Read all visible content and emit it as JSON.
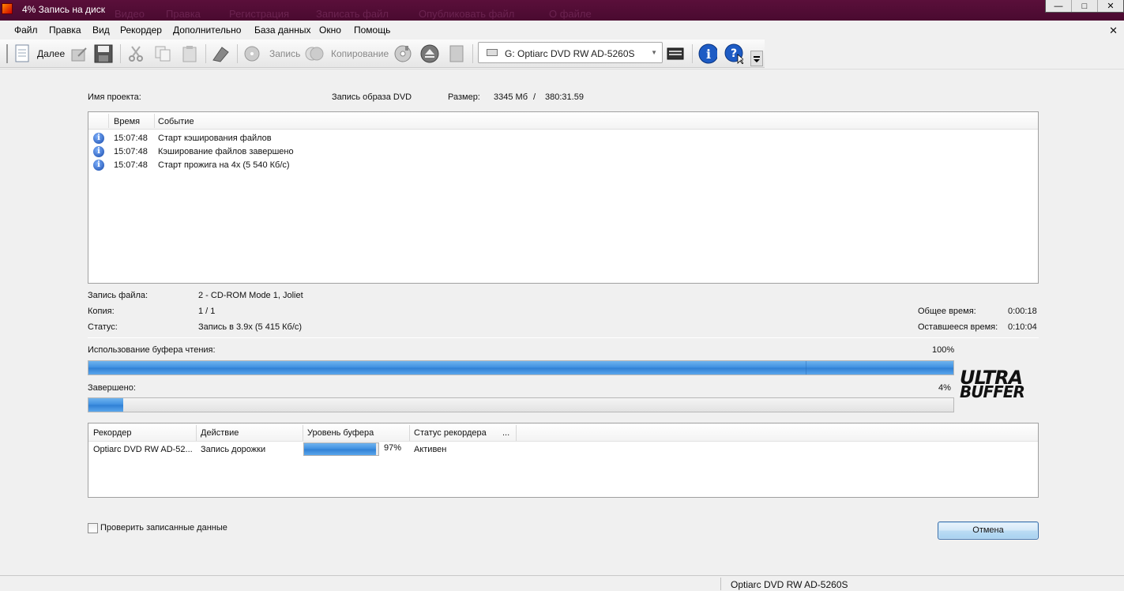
{
  "window": {
    "title": "4% Запись на диск",
    "background_menu_ghost": [
      "Видео",
      "Правка",
      "Регистрация",
      "Записать файл",
      "Опубликовать файл",
      "О файле"
    ]
  },
  "menu": {
    "items": [
      "Файл",
      "Правка",
      "Вид",
      "Рекордер",
      "Дополнительно",
      "База данных",
      "Окно",
      "Помощь"
    ]
  },
  "toolbar": {
    "next_label": "Далее",
    "burn_label": "Запись",
    "copy_label": "Копирование",
    "drive": "G: Optiarc DVD RW AD-5260S"
  },
  "project": {
    "name_label": "Имя проекта:",
    "name_value": "Запись образа DVD",
    "size_label": "Размер:",
    "size_value": "3345 Мб",
    "size_sep": "/",
    "duration": "380:31.59"
  },
  "log": {
    "columns": [
      "Время",
      "Событие"
    ],
    "rows": [
      {
        "time": "15:07:48",
        "event": "Старт кэширования файлов"
      },
      {
        "time": "15:07:48",
        "event": "Кэширование файлов завершено"
      },
      {
        "time": "15:07:48",
        "event": "Старт прожига на 4x (5 540 Кб/с)"
      }
    ]
  },
  "status": {
    "file_label": "Запись файла:",
    "file_value": "2 - CD-ROM Mode 1, Joliet",
    "copy_label": "Копия:",
    "copy_value": "1 / 1",
    "state_label": "Статус:",
    "state_value": "Запись в 3.9x (5 415 Кб/с)",
    "total_time_label": "Общее время:",
    "total_time_value": "0:00:18",
    "remaining_label": "Оставшееся время:",
    "remaining_value": "0:10:04"
  },
  "progress": {
    "buffer_label": "Использование буфера чтения:",
    "buffer_percent_text": "100%",
    "buffer_fraction": 1.0,
    "done_label": "Завершено:",
    "done_percent_text": "4%",
    "done_fraction": 0.04
  },
  "brand": {
    "line1": "ULTRA",
    "line2": "BUFFER"
  },
  "recorders": {
    "columns": [
      "Рекордер",
      "Действие",
      "Уровень буфера",
      "Статус рекордера",
      "..."
    ],
    "rows": [
      {
        "recorder": "Optiarc DVD RW AD-52...",
        "action": "Запись дорожки",
        "buffer_text": "97%",
        "buffer_fraction": 0.97,
        "status": "Активен"
      }
    ]
  },
  "footer": {
    "verify_label": "Проверить записанные данные",
    "verify_checked": false,
    "cancel_label": "Отмена"
  },
  "statusbar": {
    "drive_text": "Optiarc  DVD RW AD-5260S"
  },
  "colors": {
    "titlebar": "#5a0f3a",
    "progress_fill": "#3d8ee0"
  }
}
